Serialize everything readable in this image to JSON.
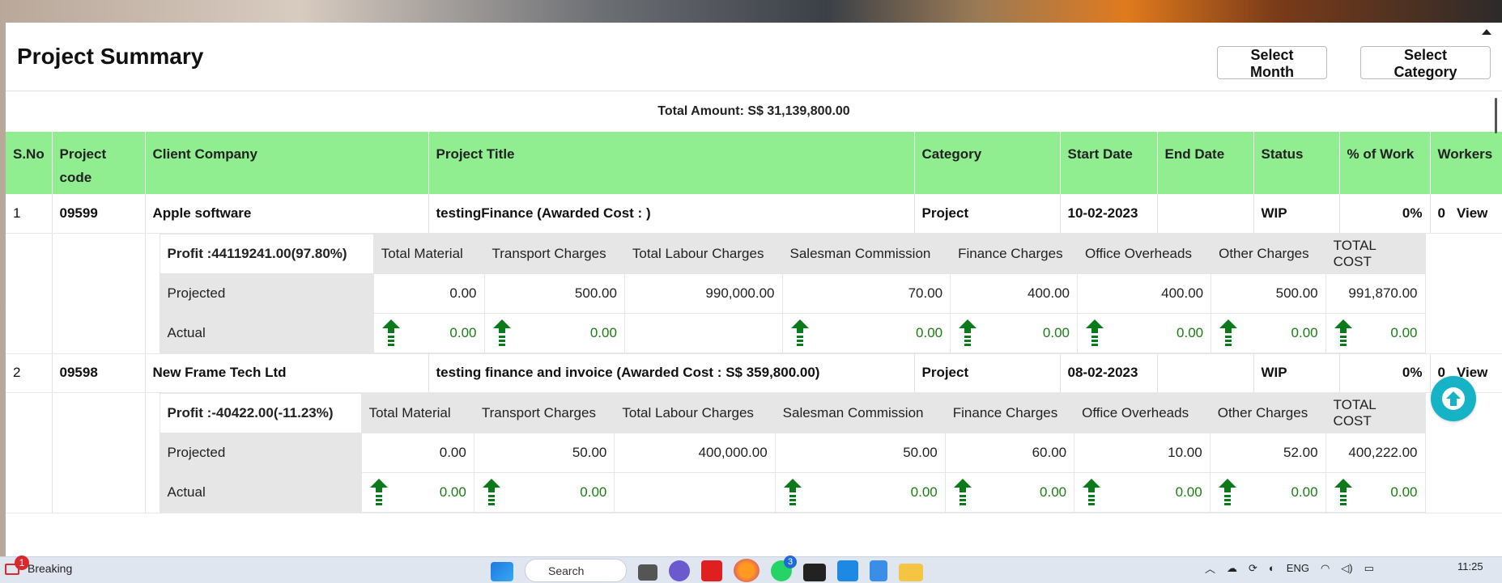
{
  "header": {
    "title": "Project Summary",
    "select_month_label": "Select Month",
    "select_category_label": "Select Category"
  },
  "summary": {
    "total_amount": "Total Amount: S$ 31,139,800.00"
  },
  "columns": [
    "S.No",
    "Project code",
    "Client Company",
    "Project Title",
    "Category",
    "Start Date",
    "End Date",
    "Status",
    "% of Work",
    "Workers"
  ],
  "cost_columns": [
    "Total Material",
    "Transport Charges",
    "Total Labour Charges",
    "Salesman Commission",
    "Finance Charges",
    "Office Overheads",
    "Other Charges",
    "TOTAL COST"
  ],
  "projects": [
    {
      "sno": "1",
      "code": "09599",
      "client": "Apple software",
      "title": "testingFinance (Awarded Cost : )",
      "category": "Project",
      "start_date": "10-02-2023",
      "end_date": "",
      "status": "WIP",
      "work_pct": "0%",
      "workers": "0",
      "view_label": "View",
      "profit": "Profit :44119241.00(97.80%)",
      "projected_label": "Projected",
      "actual_label": "Actual",
      "projected": [
        "0.00",
        "500.00",
        "990,000.00",
        "70.00",
        "400.00",
        "400.00",
        "500.00",
        "991,870.00"
      ],
      "actual": [
        "0.00",
        "0.00",
        "",
        "0.00",
        "0.00",
        "0.00",
        "0.00",
        "0.00"
      ]
    },
    {
      "sno": "2",
      "code": "09598",
      "client": "New Frame Tech Ltd",
      "title": "testing finance and invoice (Awarded Cost : S$ 359,800.00)",
      "category": "Project",
      "start_date": "08-02-2023",
      "end_date": "",
      "status": "WIP",
      "work_pct": "0%",
      "workers": "0",
      "view_label": "View",
      "profit": "Profit :-40422.00(-11.23%)",
      "projected_label": "Projected",
      "actual_label": "Actual",
      "projected": [
        "0.00",
        "50.00",
        "400,000.00",
        "50.00",
        "60.00",
        "10.00",
        "52.00",
        "400,222.00"
      ],
      "actual": [
        "0.00",
        "0.00",
        "",
        "0.00",
        "0.00",
        "0.00",
        "0.00",
        "0.00"
      ]
    }
  ],
  "taskbar": {
    "news_label": "Breaking",
    "notification_count": "1",
    "search_label": "Search",
    "whatsapp_count": "3",
    "language": "ENG",
    "time": "11:25"
  },
  "colors": {
    "header_green": "#90ee90",
    "link_blue": "#1b4f8a",
    "arrow_green": "#0b7a1a",
    "fab_cyan": "#16b3c7"
  }
}
